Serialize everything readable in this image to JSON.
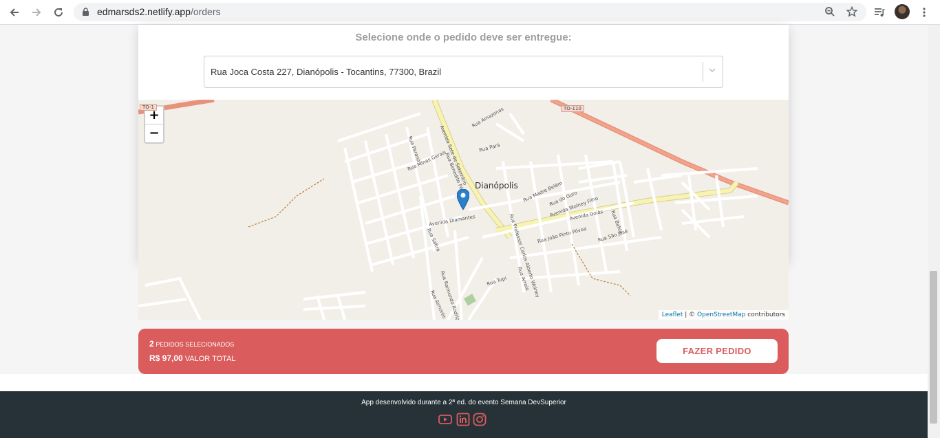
{
  "browser": {
    "url_host": "edmarsds2.netlify.app",
    "url_path": "/orders"
  },
  "orders": {
    "title": "Selecione onde o pedido deve ser entregue:",
    "selected_address": "Rua Joca Costa 227, Dianópolis - Tocantins, 77300, Brazil"
  },
  "map": {
    "zoom_in": "+",
    "zoom_out": "−",
    "city": "Dianópolis",
    "road_badge": "TO-110",
    "road_badge_left": "TO-1",
    "street_labels": [
      "Avenida Sete de Setembro",
      "Rua Amazonas",
      "Rua Pará",
      "Rua Paraná",
      "Rua Minas Gerais",
      "Rua Benedito Póvoa",
      "Rua Madre Belém",
      "Rua do Ouro",
      "Avenida Wolney Filho",
      "Avenida Goiás",
      "Rua Bahia",
      "Avenida Diamantes",
      "Rua Safira",
      "Rua Professor Carlos Alberto Wolney",
      "Rua João Pinto Póvoa",
      "Rua São José",
      "Rua Tupi",
      "Rua Arroio",
      "Rua Raimundo Rodrigues",
      "Rua Aimorés"
    ],
    "attribution_leaflet": "Leaflet",
    "attribution_sep": " | © ",
    "attribution_osm": "OpenStreetMap",
    "attribution_tail": " contributors"
  },
  "summary": {
    "count": "2",
    "count_label": "PEDIDOS SELECIONADOS",
    "total": "R$ 97,00",
    "total_label": "VALOR TOTAL",
    "button": "FAZER PEDIDO"
  },
  "footer": {
    "text": "App desenvolvido durante a 2ª ed. do evento Semana DevSuperior",
    "icons": [
      "youtube-icon",
      "linkedin-icon",
      "instagram-icon"
    ]
  },
  "colors": {
    "accent": "#da5c5c",
    "footer_bg": "#263238",
    "marker": "#2a81cb"
  }
}
